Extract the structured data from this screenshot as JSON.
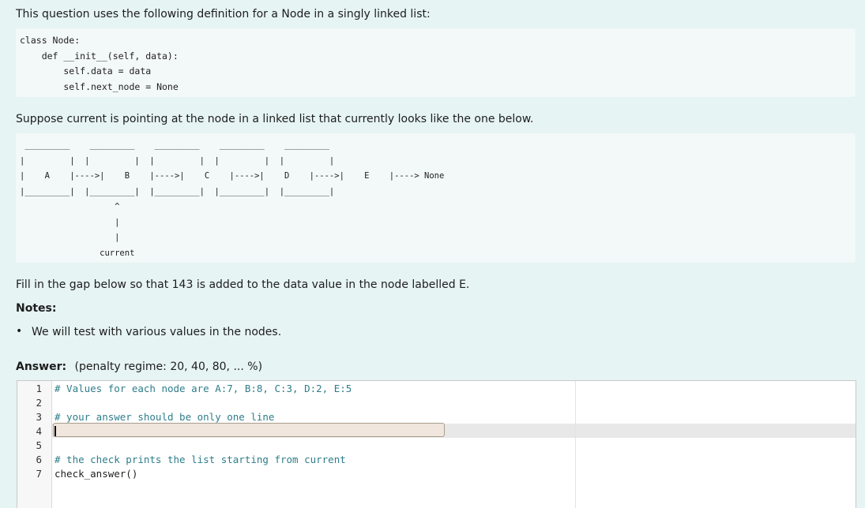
{
  "intro": "This question uses the following definition for a Node in a singly linked list:",
  "class_code": "class Node:\n    def __init__(self, data):\n        self.data = data\n        self.next_node = None",
  "suppose": "Suppose current is pointing at the node in a linked list that currently looks like the one below.",
  "diagram": " _________    _________    _________    _________    _________\n|         |  |         |  |         |  |         |  |         |\n|    A    |---->|    B    |---->|    C    |---->|    D    |---->|    E    |----> None\n|_________|  |_________|  |_________|  |_________|  |_________|\n                   ^\n                   |\n                   |\n                current",
  "fill": "Fill in the gap below so that 143 is added to the data value in the node labelled E.",
  "notes_label": "Notes:",
  "notes": [
    "We will test with various values in the nodes."
  ],
  "answer_label": "Answer:",
  "penalty": "(penalty regime: 20, 40, 80, ... %)",
  "editor": {
    "lines": [
      {
        "n": "1",
        "text": "# Values for each node are A:7, B:8, C:3, D:2, E:5",
        "kind": "comment"
      },
      {
        "n": "2",
        "text": "",
        "kind": "plain"
      },
      {
        "n": "3",
        "text": "# your answer should be only one line",
        "kind": "comment"
      },
      {
        "n": "4",
        "text": "",
        "kind": "gap"
      },
      {
        "n": "5",
        "text": "",
        "kind": "plain"
      },
      {
        "n": "6",
        "text": "# the check prints the list starting from current",
        "kind": "comment"
      },
      {
        "n": "7",
        "text": "check_answer()",
        "kind": "plain"
      }
    ],
    "gap_value": ""
  }
}
